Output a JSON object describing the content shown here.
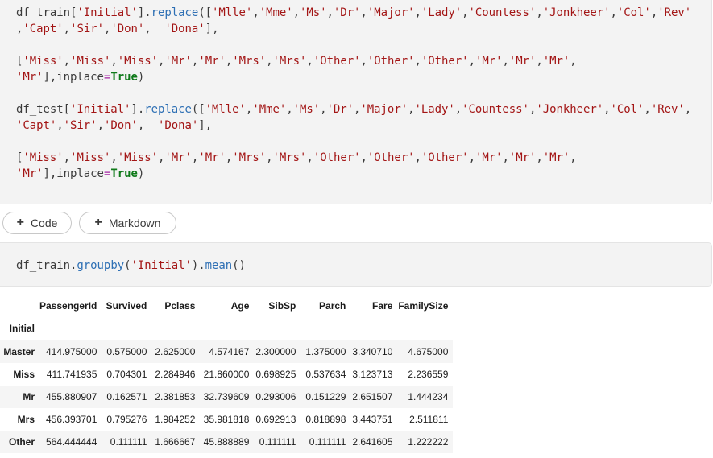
{
  "cell1": {
    "lines": [
      [
        [
          "",
          "df_train["
        ],
        [
          "s",
          "'Initial'"
        ],
        [
          "",
          "]."
        ],
        [
          "f",
          "replace"
        ],
        [
          "",
          "(["
        ],
        [
          "s",
          "'Mlle'"
        ],
        [
          "",
          ","
        ],
        [
          "s",
          "'Mme'"
        ],
        [
          "",
          ","
        ],
        [
          "s",
          "'Ms'"
        ],
        [
          "",
          ","
        ],
        [
          "s",
          "'Dr'"
        ],
        [
          "",
          ","
        ],
        [
          "s",
          "'Major'"
        ],
        [
          "",
          ","
        ],
        [
          "s",
          "'Lady'"
        ],
        [
          "",
          ","
        ],
        [
          "s",
          "'Countess'"
        ],
        [
          "",
          ","
        ],
        [
          "s",
          "'Jonkheer'"
        ],
        [
          "",
          ","
        ],
        [
          "s",
          "'Col'"
        ],
        [
          "",
          ","
        ],
        [
          "s",
          "'Rev'"
        ]
      ],
      [
        [
          "",
          ","
        ],
        [
          "s",
          "'Capt'"
        ],
        [
          "",
          ","
        ],
        [
          "s",
          "'Sir'"
        ],
        [
          "",
          ","
        ],
        [
          "s",
          "'Don'"
        ],
        [
          "",
          ",  "
        ],
        [
          "s",
          "'Dona'"
        ],
        [
          "",
          "],"
        ]
      ],
      [
        [
          "",
          ""
        ]
      ],
      [
        [
          "",
          "["
        ],
        [
          "s",
          "'Miss'"
        ],
        [
          "",
          ","
        ],
        [
          "s",
          "'Miss'"
        ],
        [
          "",
          ","
        ],
        [
          "s",
          "'Miss'"
        ],
        [
          "",
          ","
        ],
        [
          "s",
          "'Mr'"
        ],
        [
          "",
          ","
        ],
        [
          "s",
          "'Mr'"
        ],
        [
          "",
          ","
        ],
        [
          "s",
          "'Mrs'"
        ],
        [
          "",
          ","
        ],
        [
          "s",
          "'Mrs'"
        ],
        [
          "",
          ","
        ],
        [
          "s",
          "'Other'"
        ],
        [
          "",
          ","
        ],
        [
          "s",
          "'Other'"
        ],
        [
          "",
          ","
        ],
        [
          "s",
          "'Other'"
        ],
        [
          "",
          ","
        ],
        [
          "s",
          "'Mr'"
        ],
        [
          "",
          ","
        ],
        [
          "s",
          "'Mr'"
        ],
        [
          "",
          ","
        ],
        [
          "s",
          "'Mr'"
        ],
        [
          "",
          ","
        ]
      ],
      [
        [
          "s",
          "'Mr'"
        ],
        [
          "",
          "],inplace"
        ],
        [
          "o",
          "="
        ],
        [
          "k",
          "True"
        ],
        [
          "",
          ")"
        ]
      ],
      [
        [
          "",
          ""
        ]
      ],
      [
        [
          "",
          "df_test["
        ],
        [
          "s",
          "'Initial'"
        ],
        [
          "",
          "]."
        ],
        [
          "f",
          "replace"
        ],
        [
          "",
          "(["
        ],
        [
          "s",
          "'Mlle'"
        ],
        [
          "",
          ","
        ],
        [
          "s",
          "'Mme'"
        ],
        [
          "",
          ","
        ],
        [
          "s",
          "'Ms'"
        ],
        [
          "",
          ","
        ],
        [
          "s",
          "'Dr'"
        ],
        [
          "",
          ","
        ],
        [
          "s",
          "'Major'"
        ],
        [
          "",
          ","
        ],
        [
          "s",
          "'Lady'"
        ],
        [
          "",
          ","
        ],
        [
          "s",
          "'Countess'"
        ],
        [
          "",
          ","
        ],
        [
          "s",
          "'Jonkheer'"
        ],
        [
          "",
          ","
        ],
        [
          "s",
          "'Col'"
        ],
        [
          "",
          ","
        ],
        [
          "s",
          "'Rev'"
        ],
        [
          "",
          ","
        ]
      ],
      [
        [
          "s",
          "'Capt'"
        ],
        [
          "",
          ","
        ],
        [
          "s",
          "'Sir'"
        ],
        [
          "",
          ","
        ],
        [
          "s",
          "'Don'"
        ],
        [
          "",
          ",  "
        ],
        [
          "s",
          "'Dona'"
        ],
        [
          "",
          "],"
        ]
      ],
      [
        [
          "",
          ""
        ]
      ],
      [
        [
          "",
          "["
        ],
        [
          "s",
          "'Miss'"
        ],
        [
          "",
          ","
        ],
        [
          "s",
          "'Miss'"
        ],
        [
          "",
          ","
        ],
        [
          "s",
          "'Miss'"
        ],
        [
          "",
          ","
        ],
        [
          "s",
          "'Mr'"
        ],
        [
          "",
          ","
        ],
        [
          "s",
          "'Mr'"
        ],
        [
          "",
          ","
        ],
        [
          "s",
          "'Mrs'"
        ],
        [
          "",
          ","
        ],
        [
          "s",
          "'Mrs'"
        ],
        [
          "",
          ","
        ],
        [
          "s",
          "'Other'"
        ],
        [
          "",
          ","
        ],
        [
          "s",
          "'Other'"
        ],
        [
          "",
          ","
        ],
        [
          "s",
          "'Other'"
        ],
        [
          "",
          ","
        ],
        [
          "s",
          "'Mr'"
        ],
        [
          "",
          ","
        ],
        [
          "s",
          "'Mr'"
        ],
        [
          "",
          ","
        ],
        [
          "s",
          "'Mr'"
        ],
        [
          "",
          ","
        ]
      ],
      [
        [
          "s",
          "'Mr'"
        ],
        [
          "",
          "],inplace"
        ],
        [
          "o",
          "="
        ],
        [
          "k",
          "True"
        ],
        [
          "",
          ")"
        ]
      ]
    ]
  },
  "toolbar": {
    "plus_glyph": "+",
    "code_label": "Code",
    "markdown_label": "Markdown"
  },
  "cell2": {
    "lines": [
      [
        [
          "",
          "df_train."
        ],
        [
          "f",
          "groupby"
        ],
        [
          "",
          "("
        ],
        [
          "s",
          "'Initial'"
        ],
        [
          "",
          ")."
        ],
        [
          "f",
          "mean"
        ],
        [
          "",
          "()"
        ]
      ]
    ]
  },
  "output": {
    "columns": [
      "PassengerId",
      "Survived",
      "Pclass",
      "Age",
      "SibSp",
      "Parch",
      "Fare",
      "FamilySize"
    ],
    "index_name": "Initial",
    "rows": [
      {
        "index": "Master",
        "values": [
          "414.975000",
          "0.575000",
          "2.625000",
          "4.574167",
          "2.300000",
          "1.375000",
          "3.340710",
          "4.675000"
        ]
      },
      {
        "index": "Miss",
        "values": [
          "411.741935",
          "0.704301",
          "2.284946",
          "21.860000",
          "0.698925",
          "0.537634",
          "3.123713",
          "2.236559"
        ]
      },
      {
        "index": "Mr",
        "values": [
          "455.880907",
          "0.162571",
          "2.381853",
          "32.739609",
          "0.293006",
          "0.151229",
          "2.651507",
          "1.444234"
        ]
      },
      {
        "index": "Mrs",
        "values": [
          "456.393701",
          "0.795276",
          "1.984252",
          "35.981818",
          "0.692913",
          "0.818898",
          "3.443751",
          "2.511811"
        ]
      },
      {
        "index": "Other",
        "values": [
          "564.444444",
          "0.111111",
          "1.666667",
          "45.888889",
          "0.111111",
          "0.111111",
          "2.641605",
          "1.222222"
        ]
      }
    ]
  }
}
